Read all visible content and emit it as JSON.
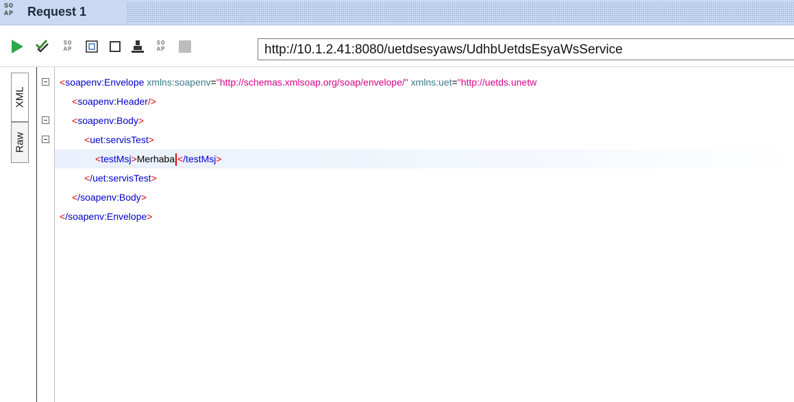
{
  "window": {
    "logo": "SO AP",
    "title": "Request 1"
  },
  "toolbar": {
    "buttons": [
      {
        "name": "submit-request-button",
        "icon": "play-icon",
        "color": "#2ba84a"
      },
      {
        "name": "validate-button",
        "icon": "check-icon",
        "color": "#3c8a2e"
      },
      {
        "name": "soap-action-button",
        "icon": "soap-icon"
      },
      {
        "name": "expand-button",
        "icon": "expand-icon"
      },
      {
        "name": "maximize-button",
        "icon": "square-icon"
      },
      {
        "name": "user-auth-button",
        "icon": "user-icon"
      },
      {
        "name": "soap-action-2-button",
        "icon": "soap-icon"
      },
      {
        "name": "stop-button",
        "icon": "stop-icon",
        "color": "#bdbdbd"
      }
    ],
    "soap_label": "SO AP",
    "endpoint": "http://10.1.2.41:8080/uetdsesyaws/UdhbUetdsEsyaWsService"
  },
  "side_tabs": {
    "xml": "XML",
    "raw": "Raw",
    "active": "XML"
  },
  "editor": {
    "envelope_open_tag": "soapenv:Envelope",
    "ns1_attr": "xmlns:soapenv",
    "ns1_value": "\"http://schemas.xmlsoap.org/soap/envelope/\"",
    "ns2_attr": "xmlns:uet",
    "ns2_value": "\"http://uetds.unetw",
    "header_tag": "soapenv:Header",
    "body_tag": "soapenv:Body",
    "op_tag": "uet:servisTest",
    "param_tag": "testMsj",
    "param_value": "Merhaba",
    "op_close_tag": "/uet:servisTest",
    "body_close_tag": "/soapenv:Body",
    "envelope_close_tag": "/soapenv:Envelope",
    "param_close_tag": "/testMsj"
  },
  "colors": {
    "tag": "#0000cc",
    "bracket": "#e00000",
    "attribute": "#3a7a8c",
    "value": "#d60086",
    "title_bar": "#c9d9f1"
  }
}
